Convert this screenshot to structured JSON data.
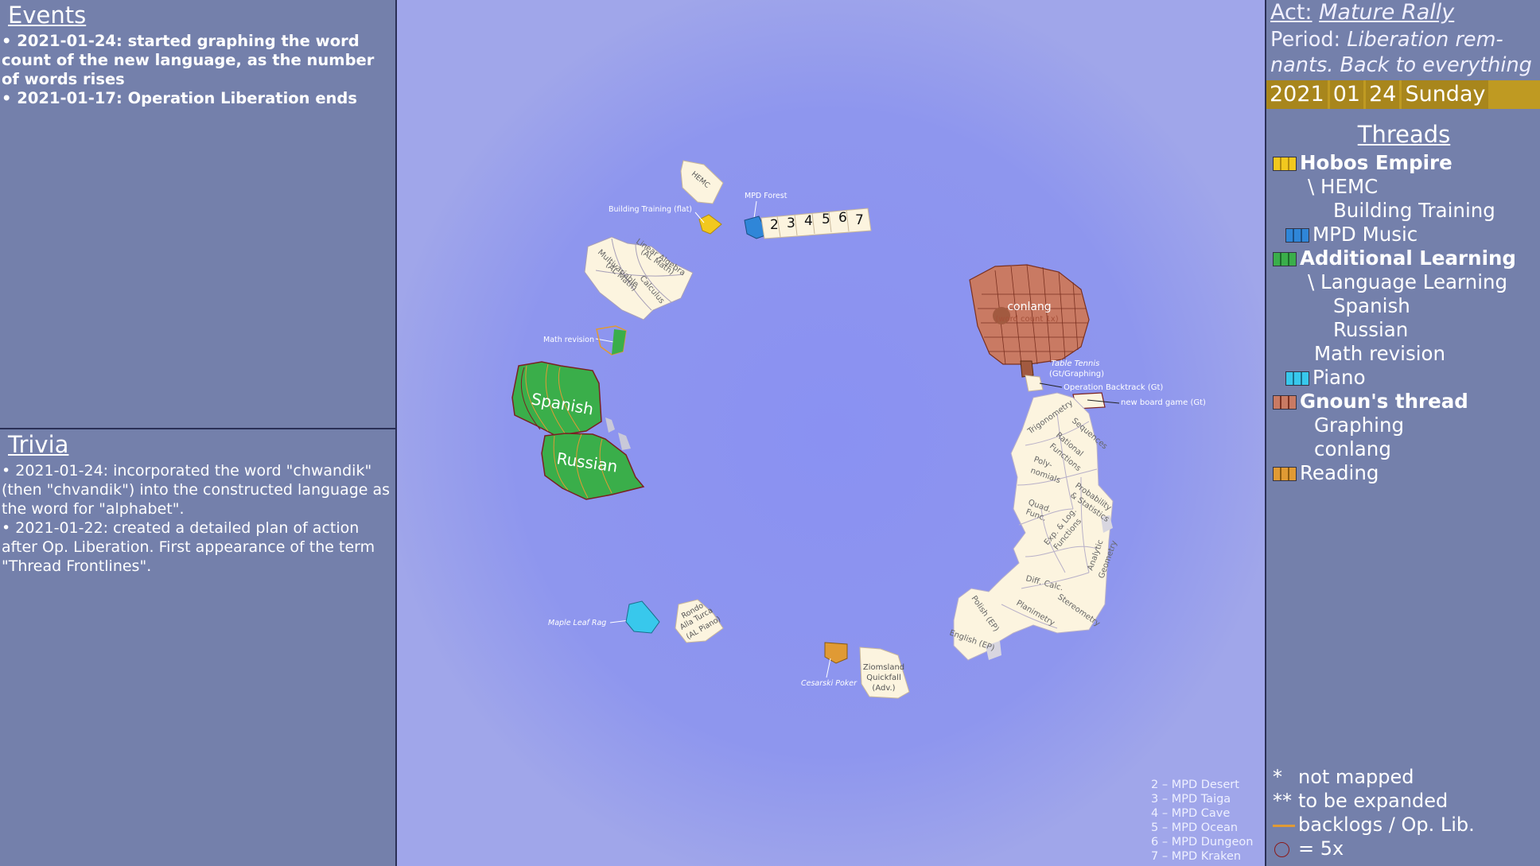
{
  "events": {
    "title": "Events",
    "items": [
      "• 2021-01-24: started graphing the word count of the new language, as the number of words rises",
      "• 2021-01-17: Operation Liberation ends"
    ]
  },
  "trivia": {
    "title": "Trivia",
    "items": [
      "• 2021-01-24: incorporated the word \"chwandik\" (then \"chvandik\") into the constructed language as the word for \"alphabet\".",
      "• 2021-01-22: created a detailed plan of action after Op. Liberation. First appearance of the term \"Thread Frontlines\"."
    ]
  },
  "header": {
    "act_label": "Act:",
    "act_value": "Mature Rally",
    "period_label": "Period:",
    "period_value": "Liberation rem- nants. Back to everything",
    "date": {
      "year": "2021",
      "month": "01",
      "day": "24",
      "weekday": "Sunday"
    }
  },
  "threads": {
    "title": "Threads",
    "items": [
      {
        "label": "Hobos Empire",
        "bold": true,
        "color": "#f2c81e"
      },
      {
        "label": "\\ HEMC"
      },
      {
        "label": "Building Training"
      },
      {
        "label": "MPD Music",
        "color": "#2f86d8"
      },
      {
        "label": "Additional Learning",
        "bold": true,
        "color": "#3aae4a"
      },
      {
        "label": "\\ Language Learning"
      },
      {
        "label": "Spanish"
      },
      {
        "label": "Russian"
      },
      {
        "label": "Math revision"
      },
      {
        "label": "Piano",
        "color": "#38c8ec"
      },
      {
        "label": "Gnoun's thread",
        "bold": true,
        "color": "#c97a63"
      },
      {
        "label": "Graphing"
      },
      {
        "label": "conlang"
      },
      {
        "label": "Reading",
        "color": "#e09a34"
      }
    ]
  },
  "legend": {
    "not_mapped_mark": "*",
    "not_mapped": "not mapped",
    "to_expand_mark": "**",
    "to_expand": "to be expanded",
    "backlogs": "backlogs / Op. Lib.",
    "five_x": "= 5x"
  },
  "map": {
    "labels": {
      "hemc": "HEMC",
      "building_training": "Building Training (flat)",
      "mpd_forest": "MPD Forest",
      "mpd_numbers": [
        "2",
        "3",
        "4",
        "5",
        "6",
        "7"
      ],
      "linear_algebra": "Linear Algebra",
      "linear_algebra_sub": "(AL Math)",
      "multivariable": "Multivariable",
      "multivariable_sub": "(AL Math)",
      "calculus": "Calculus",
      "math_revision": "Math revision",
      "spanish": "Spanish",
      "russian": "Russian",
      "conlang": "conlang",
      "conlang_sub": "(word count 1x)",
      "table_tennis": "Table Tennis",
      "table_tennis_sub": "(Gt/Graphing)",
      "operation_backtrack": "Operation Backtrack (Gt)",
      "new_board_game": "new board game (Gt)",
      "trigonometry": "Trigonometry",
      "sequences": "Sequences",
      "rational": "Rational",
      "functions": "Functions",
      "polynomials_1": "Poly-",
      "polynomials_2": "nomials",
      "probability_1": "Probability",
      "probability_2": "& Statistics",
      "quad_1": "Quad.",
      "quad_2": "Func.",
      "exp_1": "Exp. & Log.",
      "exp_2": "Functions",
      "analytic": "Analytic",
      "geometry": "Geometry",
      "diff_calc": "Diff. Calc.",
      "polish": "Polish (EP)",
      "planimetry": "Planimetry",
      "stereometry": "Stereometry",
      "english": "English (EP)",
      "maple_leaf": "Maple Leaf Rag",
      "rondo_1": "Rondo",
      "rondo_2": "Alla Turca",
      "rondo_3": "(AL Piano)",
      "cesarski": "Cesarski Poker",
      "ziomsland_1": "Ziomsland",
      "ziomsland_2": "Quickfall",
      "ziomsland_3": "(Adv.)"
    },
    "mpd_legend": [
      "2 – MPD Desert",
      "3 – MPD Taiga",
      "4 – MPD Cave",
      "5 – MPD Ocean",
      "6 – MPD Dungeon",
      "7 – MPD Kraken"
    ]
  }
}
